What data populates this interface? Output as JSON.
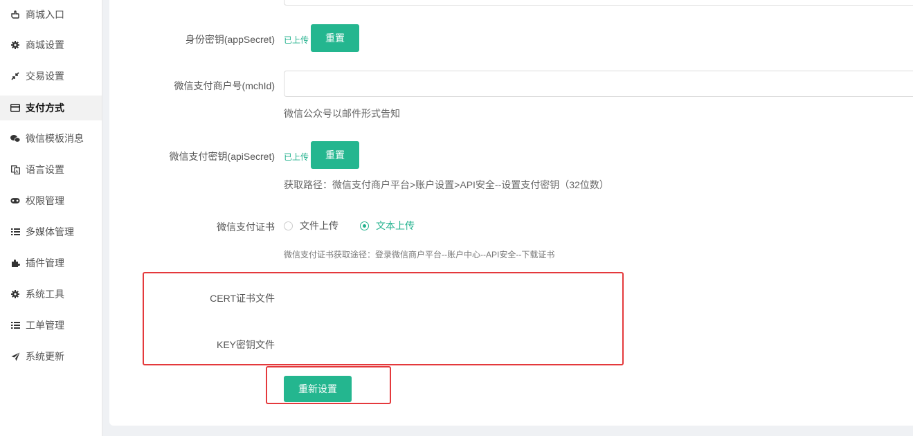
{
  "sidebar": {
    "items": [
      {
        "label": "商城入口",
        "icon": "hand-point-icon"
      },
      {
        "label": "商城设置",
        "icon": "gear-icon"
      },
      {
        "label": "交易设置",
        "icon": "arrows-compress-icon"
      },
      {
        "label": "支付方式",
        "icon": "credit-card-icon",
        "active": true
      },
      {
        "label": "微信模板消息",
        "icon": "wechat-icon"
      },
      {
        "label": "语言设置",
        "icon": "translate-icon"
      },
      {
        "label": "权限管理",
        "icon": "gamepad-icon"
      },
      {
        "label": "多媒体管理",
        "icon": "list-icon"
      },
      {
        "label": "插件管理",
        "icon": "puzzle-icon"
      },
      {
        "label": "系统工具",
        "icon": "gear-icon"
      },
      {
        "label": "工单管理",
        "icon": "list-icon"
      },
      {
        "label": "系统更新",
        "icon": "paper-plane-icon"
      }
    ]
  },
  "form": {
    "app_secret": {
      "label": "身份密钥(appSecret)",
      "status": "已上传",
      "button": "重置"
    },
    "mch_id": {
      "label": "微信支付商户号(mchId)",
      "value": "",
      "hint": "微信公众号以邮件形式告知"
    },
    "api_secret": {
      "label": "微信支付密钥(apiSecret)",
      "status": "已上传",
      "button": "重置",
      "hint": "获取路径：微信支付商户平台>账户设置>API安全--设置支付密钥（32位数）"
    },
    "cert": {
      "label": "微信支付证书",
      "options": [
        {
          "label": "文件上传",
          "selected": false
        },
        {
          "label": "文本上传",
          "selected": true
        }
      ],
      "hint": "微信支付证书获取途径：登录微信商户平台--账户中心--API安全--下载证书"
    },
    "cert_file": {
      "label": "CERT证书文件"
    },
    "key_file": {
      "label": "KEY密钥文件"
    },
    "submit": "重新设置"
  },
  "colors": {
    "accent": "#24b68f",
    "highlight": "#e4393c"
  }
}
